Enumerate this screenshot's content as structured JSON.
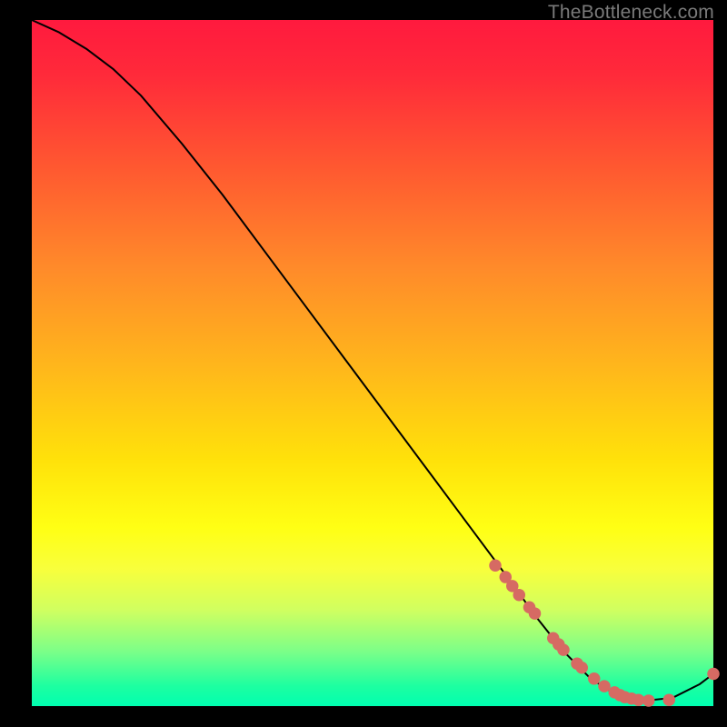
{
  "watermark": "TheBottleneck.com",
  "chart_data": {
    "type": "line",
    "title": "",
    "xlabel": "",
    "ylabel": "",
    "xlim": [
      0,
      100
    ],
    "ylim": [
      0,
      100
    ],
    "grid": false,
    "series": [
      {
        "name": "curve",
        "color": "#000000",
        "x": [
          0,
          4,
          8,
          12,
          16,
          22,
          28,
          34,
          40,
          46,
          52,
          58,
          64,
          70,
          74,
          78,
          82,
          86,
          90,
          94,
          98,
          100
        ],
        "y": [
          100,
          98.2,
          95.8,
          92.8,
          89.0,
          82.0,
          74.5,
          66.5,
          58.5,
          50.5,
          42.5,
          34.5,
          26.5,
          18.5,
          13.0,
          8.0,
          4.0,
          1.5,
          0.8,
          1.2,
          3.2,
          4.7
        ]
      }
    ],
    "markers": {
      "name": "points",
      "color": "#d66a63",
      "radius_frac": 0.009,
      "x": [
        68,
        69.5,
        70.5,
        71.5,
        73,
        73.8,
        76.5,
        77.3,
        78,
        80,
        80.7,
        82.5,
        84,
        85.5,
        86.3,
        87,
        88,
        89,
        90.5,
        93.5,
        100
      ],
      "y": [
        20.5,
        18.8,
        17.5,
        16.2,
        14.4,
        13.5,
        9.9,
        9.0,
        8.2,
        6.2,
        5.6,
        4.0,
        2.9,
        2.0,
        1.6,
        1.3,
        1.1,
        0.9,
        0.8,
        0.9,
        4.7
      ]
    }
  }
}
